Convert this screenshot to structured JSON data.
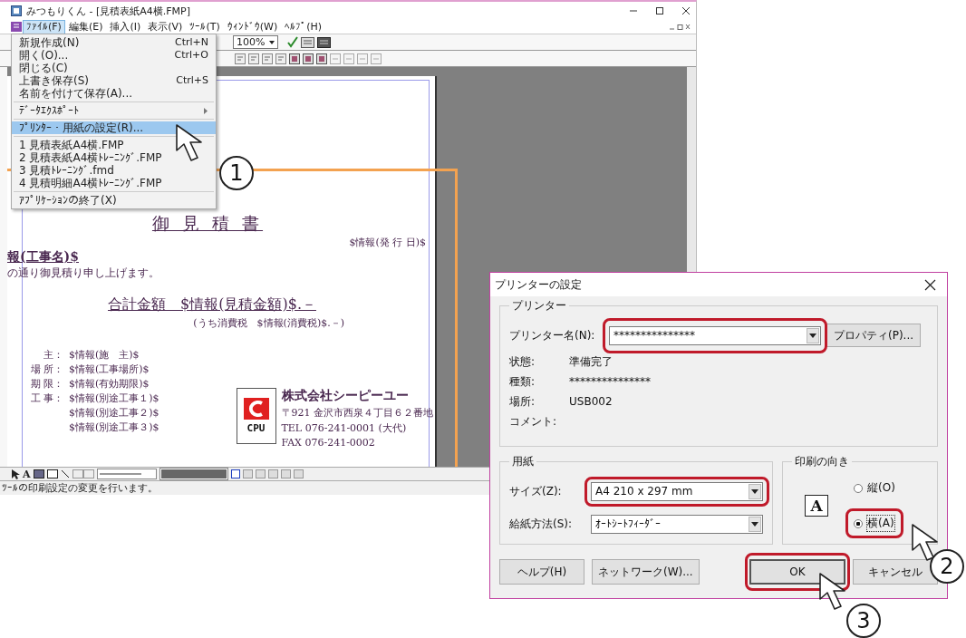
{
  "app_window": {
    "title": "みつもりくん - [見積表紙A4横.FMP]",
    "menu_bar": [
      {
        "label": "ﾌｧｲﾙ(F)",
        "selected": true
      },
      {
        "label": "編集(E)",
        "selected": false
      },
      {
        "label": "挿入(I)",
        "selected": false
      },
      {
        "label": "表示(V)",
        "selected": false
      },
      {
        "label": "ﾂｰﾙ(T)",
        "selected": false
      },
      {
        "label": "ｳｨﾝﾄﾞｳ(W)",
        "selected": false
      },
      {
        "label": "ﾍﾙﾌﾟ(H)",
        "selected": false
      }
    ],
    "file_menu": [
      {
        "kind": "item",
        "label": "新規作成(N)",
        "shortcut": "Ctrl+N",
        "selected": false
      },
      {
        "kind": "item",
        "label": "開く(O)...",
        "shortcut": "Ctrl+O",
        "selected": false
      },
      {
        "kind": "item",
        "label": "閉じる(C)",
        "selected": false
      },
      {
        "kind": "item",
        "label": "上書き保存(S)",
        "shortcut": "Ctrl+S",
        "selected": false
      },
      {
        "kind": "item",
        "label": "名前を付けて保存(A)...",
        "selected": false
      },
      {
        "kind": "separator"
      },
      {
        "kind": "submenu",
        "label": "ﾃﾞｰﾀｴｸｽﾎﾟｰﾄ",
        "selected": false
      },
      {
        "kind": "separator"
      },
      {
        "kind": "item",
        "label": "ﾌﾟﾘﾝﾀｰ・用紙の設定(R)...",
        "selected": true
      },
      {
        "kind": "separator"
      },
      {
        "kind": "item",
        "label": "1 見積表紙A4横.FMP",
        "selected": false
      },
      {
        "kind": "item",
        "label": "2 見積表紙A4横ﾄﾚｰﾆﾝｸﾞ.FMP",
        "selected": false
      },
      {
        "kind": "item",
        "label": "3 見積ﾄﾚｰﾆﾝｸﾞ.fmd",
        "selected": false
      },
      {
        "kind": "item",
        "label": "4 見積明細A4横ﾄﾚｰﾆﾝｸﾞ.FMP",
        "selected": false
      },
      {
        "kind": "separator"
      },
      {
        "kind": "item",
        "label": "ｱﾌﾟﾘｹｰｼｮﾝの終了(X)",
        "selected": false
      }
    ],
    "zoom": "100%",
    "text_tool": "A",
    "document": {
      "title": "御 見 積 書",
      "issue_date": "$情報(発 行 日)$",
      "project_name": "報(工事名)$",
      "greeting": "の通り御見積り申し上げます。",
      "total": "合計金額　$情報(見積金額)$.－",
      "tax": "(うち消費税　$情報(消費税)$.－)",
      "fields": [
        {
          "label": "主：",
          "value": "$情報(施　主)$"
        },
        {
          "label": "場 所：",
          "value": "$情報(工事場所)$"
        },
        {
          "label": "期 限：",
          "value": "$情報(有効期限)$"
        },
        {
          "label": "工 事：",
          "value": "$情報(別途工事１)$"
        },
        {
          "value": "$情報(別途工事２)$"
        },
        {
          "value": "$情報(別途工事３)$"
        }
      ],
      "company": {
        "logo_text": "CPU",
        "name": "株式会社シーピーユー",
        "address": "〒921 金沢市西泉４丁目６２番地",
        "tel": "TEL 076-241-0001 (大代)",
        "fax": "FAX 076-241-0002"
      }
    },
    "status_bar": "ﾂｰﾙの印刷設定の変更を行います。"
  },
  "dialog": {
    "title": "プリンターの設定",
    "printer_group": {
      "label": "プリンター",
      "name_label": "プリンター名(N):",
      "name_value": "***************",
      "properties_button": "プロパティ(P)...",
      "info": [
        {
          "label": "状態:",
          "value": "準備完了"
        },
        {
          "label": "種類:",
          "value": "***************"
        },
        {
          "label": "場所:",
          "value": "USB002"
        },
        {
          "label": "コメント:"
        }
      ]
    },
    "paper_group": {
      "label": "用紙",
      "size_label": "サイズ(Z):",
      "size_value": "A4 210 x 297 mm",
      "source_label": "給紙方法(S):",
      "source_value": "ｵｰﾄｼｰﾄﾌｨｰﾀﾞｰ"
    },
    "orientation_group": {
      "label": "印刷の向き",
      "icon_letter": "A",
      "options": [
        {
          "label": "縦(O)",
          "selected": false
        },
        {
          "label": "横(A)",
          "selected": true
        }
      ]
    },
    "buttons": [
      {
        "label": "ヘルプ(H)",
        "kind": "normal"
      },
      {
        "label": "ネットワーク(W)...",
        "kind": "normal"
      },
      {
        "label": "OK",
        "kind": "default"
      },
      {
        "label": "キャンセル",
        "kind": "normal"
      }
    ]
  },
  "callouts": [
    {
      "number": "1"
    },
    {
      "number": "2"
    },
    {
      "number": "3"
    }
  ]
}
